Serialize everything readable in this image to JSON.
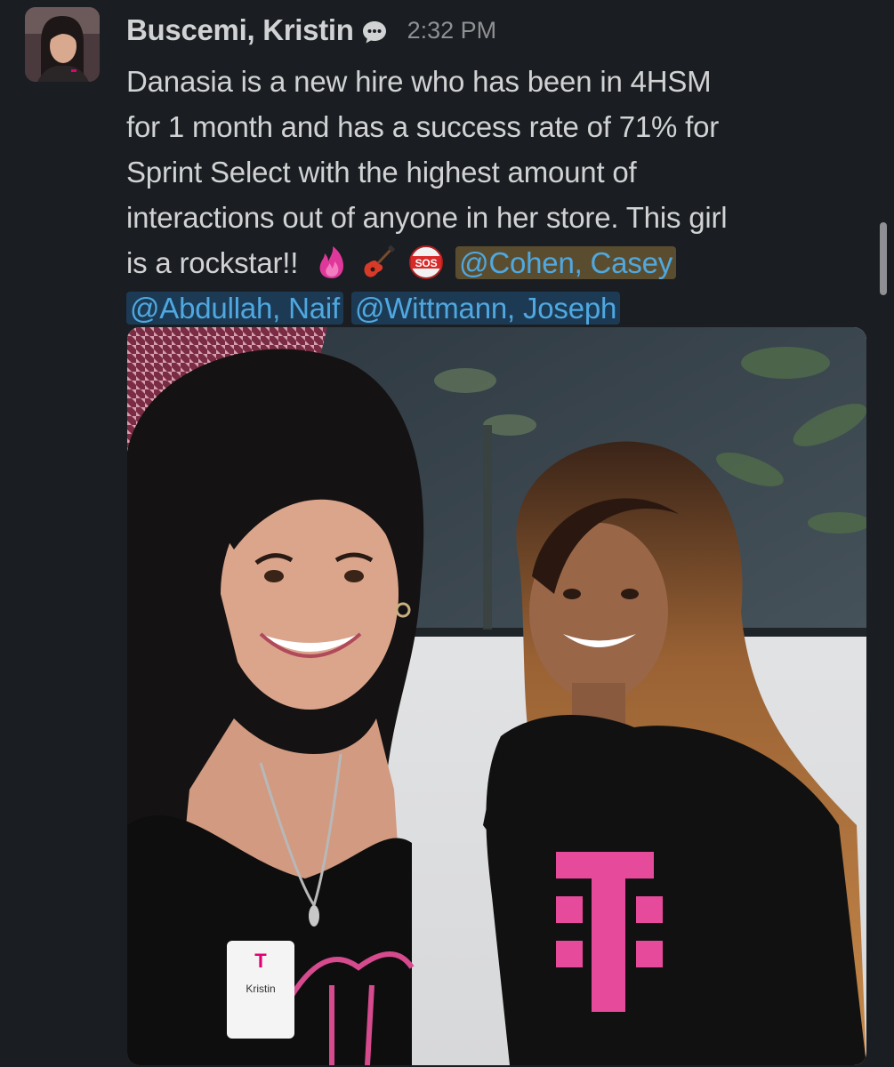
{
  "message": {
    "author": "Buscemi, Kristin",
    "timestamp": "2:32 PM",
    "text_lines": [
      "Danasia is a new hire who has been in 4HSM",
      "for 1 month and has a success rate of 71% for",
      "Sprint Select with the highest amount of",
      "interactions out of anyone in her store. This girl",
      "is a rockstar!!"
    ],
    "emojis": [
      "fire-icon",
      "guitar-icon",
      "sos-icon"
    ],
    "mentions": [
      "@Cohen, Casey",
      "@Abdullah, Naif",
      "@Wittmann, Joseph"
    ],
    "badge_text": "Kristin"
  },
  "colors": {
    "background": "#1a1d21",
    "text": "#d1d2d3",
    "mention": "#4fa8e0",
    "brand_magenta": "#e20074"
  }
}
